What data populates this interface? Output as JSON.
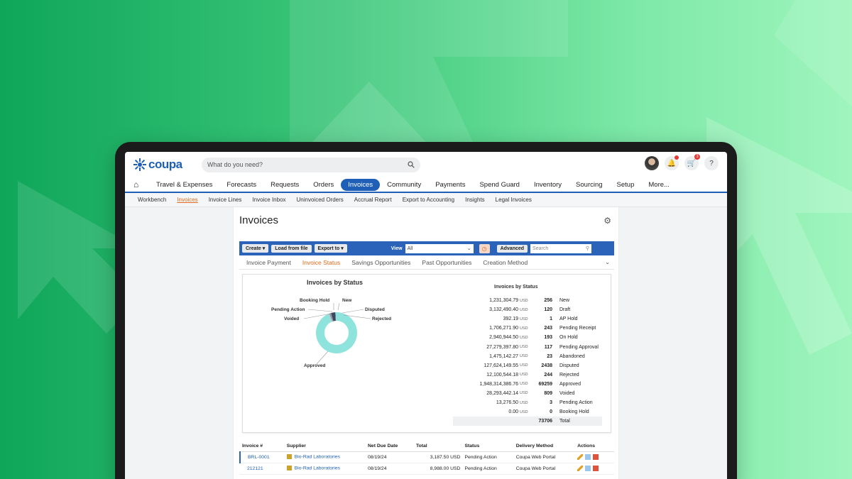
{
  "logo": {
    "text": "coupa"
  },
  "search": {
    "placeholder": "What do you need?"
  },
  "header": {
    "cart_count": "3"
  },
  "mainnav": [
    "Travel & Expenses",
    "Forecasts",
    "Requests",
    "Orders",
    "Invoices",
    "Community",
    "Payments",
    "Spend Guard",
    "Inventory",
    "Sourcing",
    "Setup",
    "More..."
  ],
  "mainnav_active": "Invoices",
  "subnav": [
    "Workbench",
    "Invoices",
    "Invoice Lines",
    "Invoice Inbox",
    "Uninvoiced Orders",
    "Accrual Report",
    "Export to Accounting",
    "Insights",
    "Legal Invoices"
  ],
  "subnav_active": "Invoices",
  "page": {
    "title": "Invoices"
  },
  "toolbar": {
    "create": "Create",
    "load": "Load from file",
    "export": "Export to",
    "view_label": "View",
    "view_value": "All",
    "advanced": "Advanced",
    "search_placeholder": "Search"
  },
  "tabs": [
    "Invoice Payment",
    "Invoice Status",
    "Savings Opportunities",
    "Past Opportunities",
    "Creation Method"
  ],
  "tabs_active": "Invoice Status",
  "chart": {
    "title": "Invoices by Status",
    "labels": [
      "Booking Hold",
      "New",
      "Pending Action",
      "Disputed",
      "Voided",
      "Rejected",
      "Approved"
    ]
  },
  "chart_data": {
    "type": "pie",
    "title": "Invoices by Status",
    "categories": [
      "New",
      "Draft",
      "AP Hold",
      "Pending Receipt",
      "On Hold",
      "Pending Approval",
      "Abandoned",
      "Disputed",
      "Rejected",
      "Approved",
      "Voided",
      "Pending Action",
      "Booking Hold"
    ],
    "values": [
      256,
      120,
      1,
      243,
      193,
      117,
      23,
      2438,
      244,
      69259,
      809,
      3,
      0
    ],
    "colors": {
      "Approved": "#8ee3dc",
      "Disputed": "#3a4a5c",
      "New": "#5a6b7d",
      "Rejected": "#7fb6d9",
      "Voided": "#b9c4cf"
    }
  },
  "status_table": {
    "title": "Invoices by Status",
    "currency": "USD",
    "rows": [
      {
        "amount": "1,231,304.79",
        "count": "256",
        "label": "New"
      },
      {
        "amount": "3,132,490.40",
        "count": "120",
        "label": "Draft"
      },
      {
        "amount": "392.19",
        "count": "1",
        "label": "AP Hold"
      },
      {
        "amount": "1,706,271.90",
        "count": "243",
        "label": "Pending Receipt"
      },
      {
        "amount": "2,940,944.50",
        "count": "193",
        "label": "On Hold"
      },
      {
        "amount": "27,279,397.80",
        "count": "117",
        "label": "Pending Approval"
      },
      {
        "amount": "1,475,142.27",
        "count": "23",
        "label": "Abandoned"
      },
      {
        "amount": "127,624,149.55",
        "count": "2438",
        "label": "Disputed"
      },
      {
        "amount": "12,100,544.18",
        "count": "244",
        "label": "Rejected"
      },
      {
        "amount": "1,948,314,386.76",
        "count": "69259",
        "label": "Approved"
      },
      {
        "amount": "28,293,442.14",
        "count": "809",
        "label": "Voided"
      },
      {
        "amount": "13,276.50",
        "count": "3",
        "label": "Pending Action"
      },
      {
        "amount": "0.00",
        "count": "0",
        "label": "Booking Hold"
      }
    ],
    "total_count": "73706",
    "total_label": "Total"
  },
  "invoice_table": {
    "headers": [
      "Invoice #",
      "Supplier",
      "Net Due Date",
      "Total",
      "Status",
      "Delivery Method",
      "Actions"
    ],
    "rows": [
      {
        "invoice": "BRL-0001",
        "supplier": "Bio-Rad Laboratories",
        "due": "08/19/24",
        "total": "3,187.50 USD",
        "status": "Pending Action",
        "delivery": "Coupa Web Portal"
      },
      {
        "invoice": "212121",
        "supplier": "Bio-Rad Laboratories",
        "due": "08/19/24",
        "total": "8,988.00 USD",
        "status": "Pending Action",
        "delivery": "Coupa Web Portal"
      }
    ]
  }
}
